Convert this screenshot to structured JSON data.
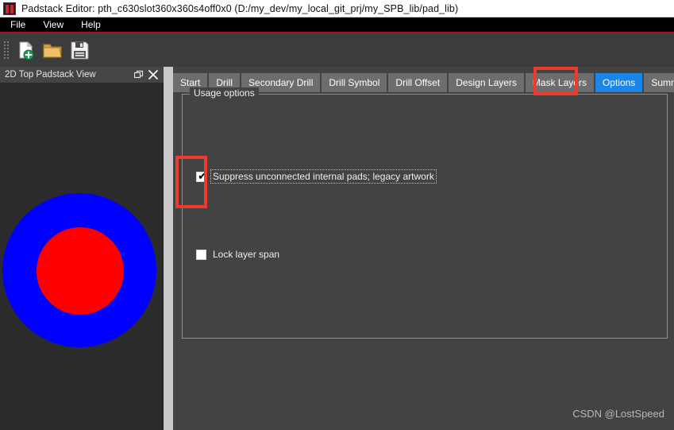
{
  "window": {
    "app_icon": "padstack-icon",
    "title": "Padstack Editor: pth_c630slot360x360s4off0x0  (D:/my_dev/my_local_git_prj/my_SPB_lib/pad_lib)"
  },
  "menubar": {
    "items": [
      {
        "label": "File",
        "name": "menu-file"
      },
      {
        "label": "View",
        "name": "menu-view"
      },
      {
        "label": "Help",
        "name": "menu-help"
      }
    ]
  },
  "toolbar": {
    "buttons": [
      {
        "label": "New",
        "icon": "new-file-icon"
      },
      {
        "label": "Open",
        "icon": "open-folder-icon"
      },
      {
        "label": "Save",
        "icon": "save-disk-icon"
      }
    ]
  },
  "dock": {
    "title": "2D Top Padstack View",
    "float_icon": "float-window-icon",
    "close_icon": "close-icon",
    "pad_preview": {
      "outer_shape": "circle",
      "outer_color": "#0000FF",
      "inner_shape": "circle",
      "inner_color": "#FF0000"
    }
  },
  "tabs": [
    {
      "label": "Start",
      "name": "tab-start",
      "selected": false
    },
    {
      "label": "Drill",
      "name": "tab-drill",
      "selected": false
    },
    {
      "label": "Secondary Drill",
      "name": "tab-secondary-drill",
      "selected": false
    },
    {
      "label": "Drill Symbol",
      "name": "tab-drill-symbol",
      "selected": false
    },
    {
      "label": "Drill Offset",
      "name": "tab-drill-offset",
      "selected": false
    },
    {
      "label": "Design Layers",
      "name": "tab-design-layers",
      "selected": false
    },
    {
      "label": "Mask Layers",
      "name": "tab-mask-layers",
      "selected": false
    },
    {
      "label": "Options",
      "name": "tab-options",
      "selected": true
    },
    {
      "label": "Summary",
      "name": "tab-summary",
      "selected": false
    }
  ],
  "options_page": {
    "group_title": "Usage options",
    "checkboxes": [
      {
        "label": "Suppress unconnected internal pads; legacy artwork",
        "checked": true,
        "focused": true,
        "check_glyph": "✔"
      },
      {
        "label": "Lock layer span",
        "checked": false,
        "focused": false,
        "check_glyph": ""
      }
    ]
  },
  "annotations": {
    "color": "#ef3b2d",
    "boxes": [
      {
        "target": "tab-options"
      },
      {
        "target": "suppress-unconnected-checkbox"
      }
    ]
  },
  "watermark": "CSDN @LostSpeed",
  "colors": {
    "accent_tab_selected": "#1c86e8",
    "annotation_red": "#ef3b2d",
    "menu_underline_red": "#a81212",
    "pad_outer": "#0000FF",
    "pad_inner": "#FF0000",
    "window_bg": "#434343",
    "dock_bg": "#2b2b2b"
  }
}
